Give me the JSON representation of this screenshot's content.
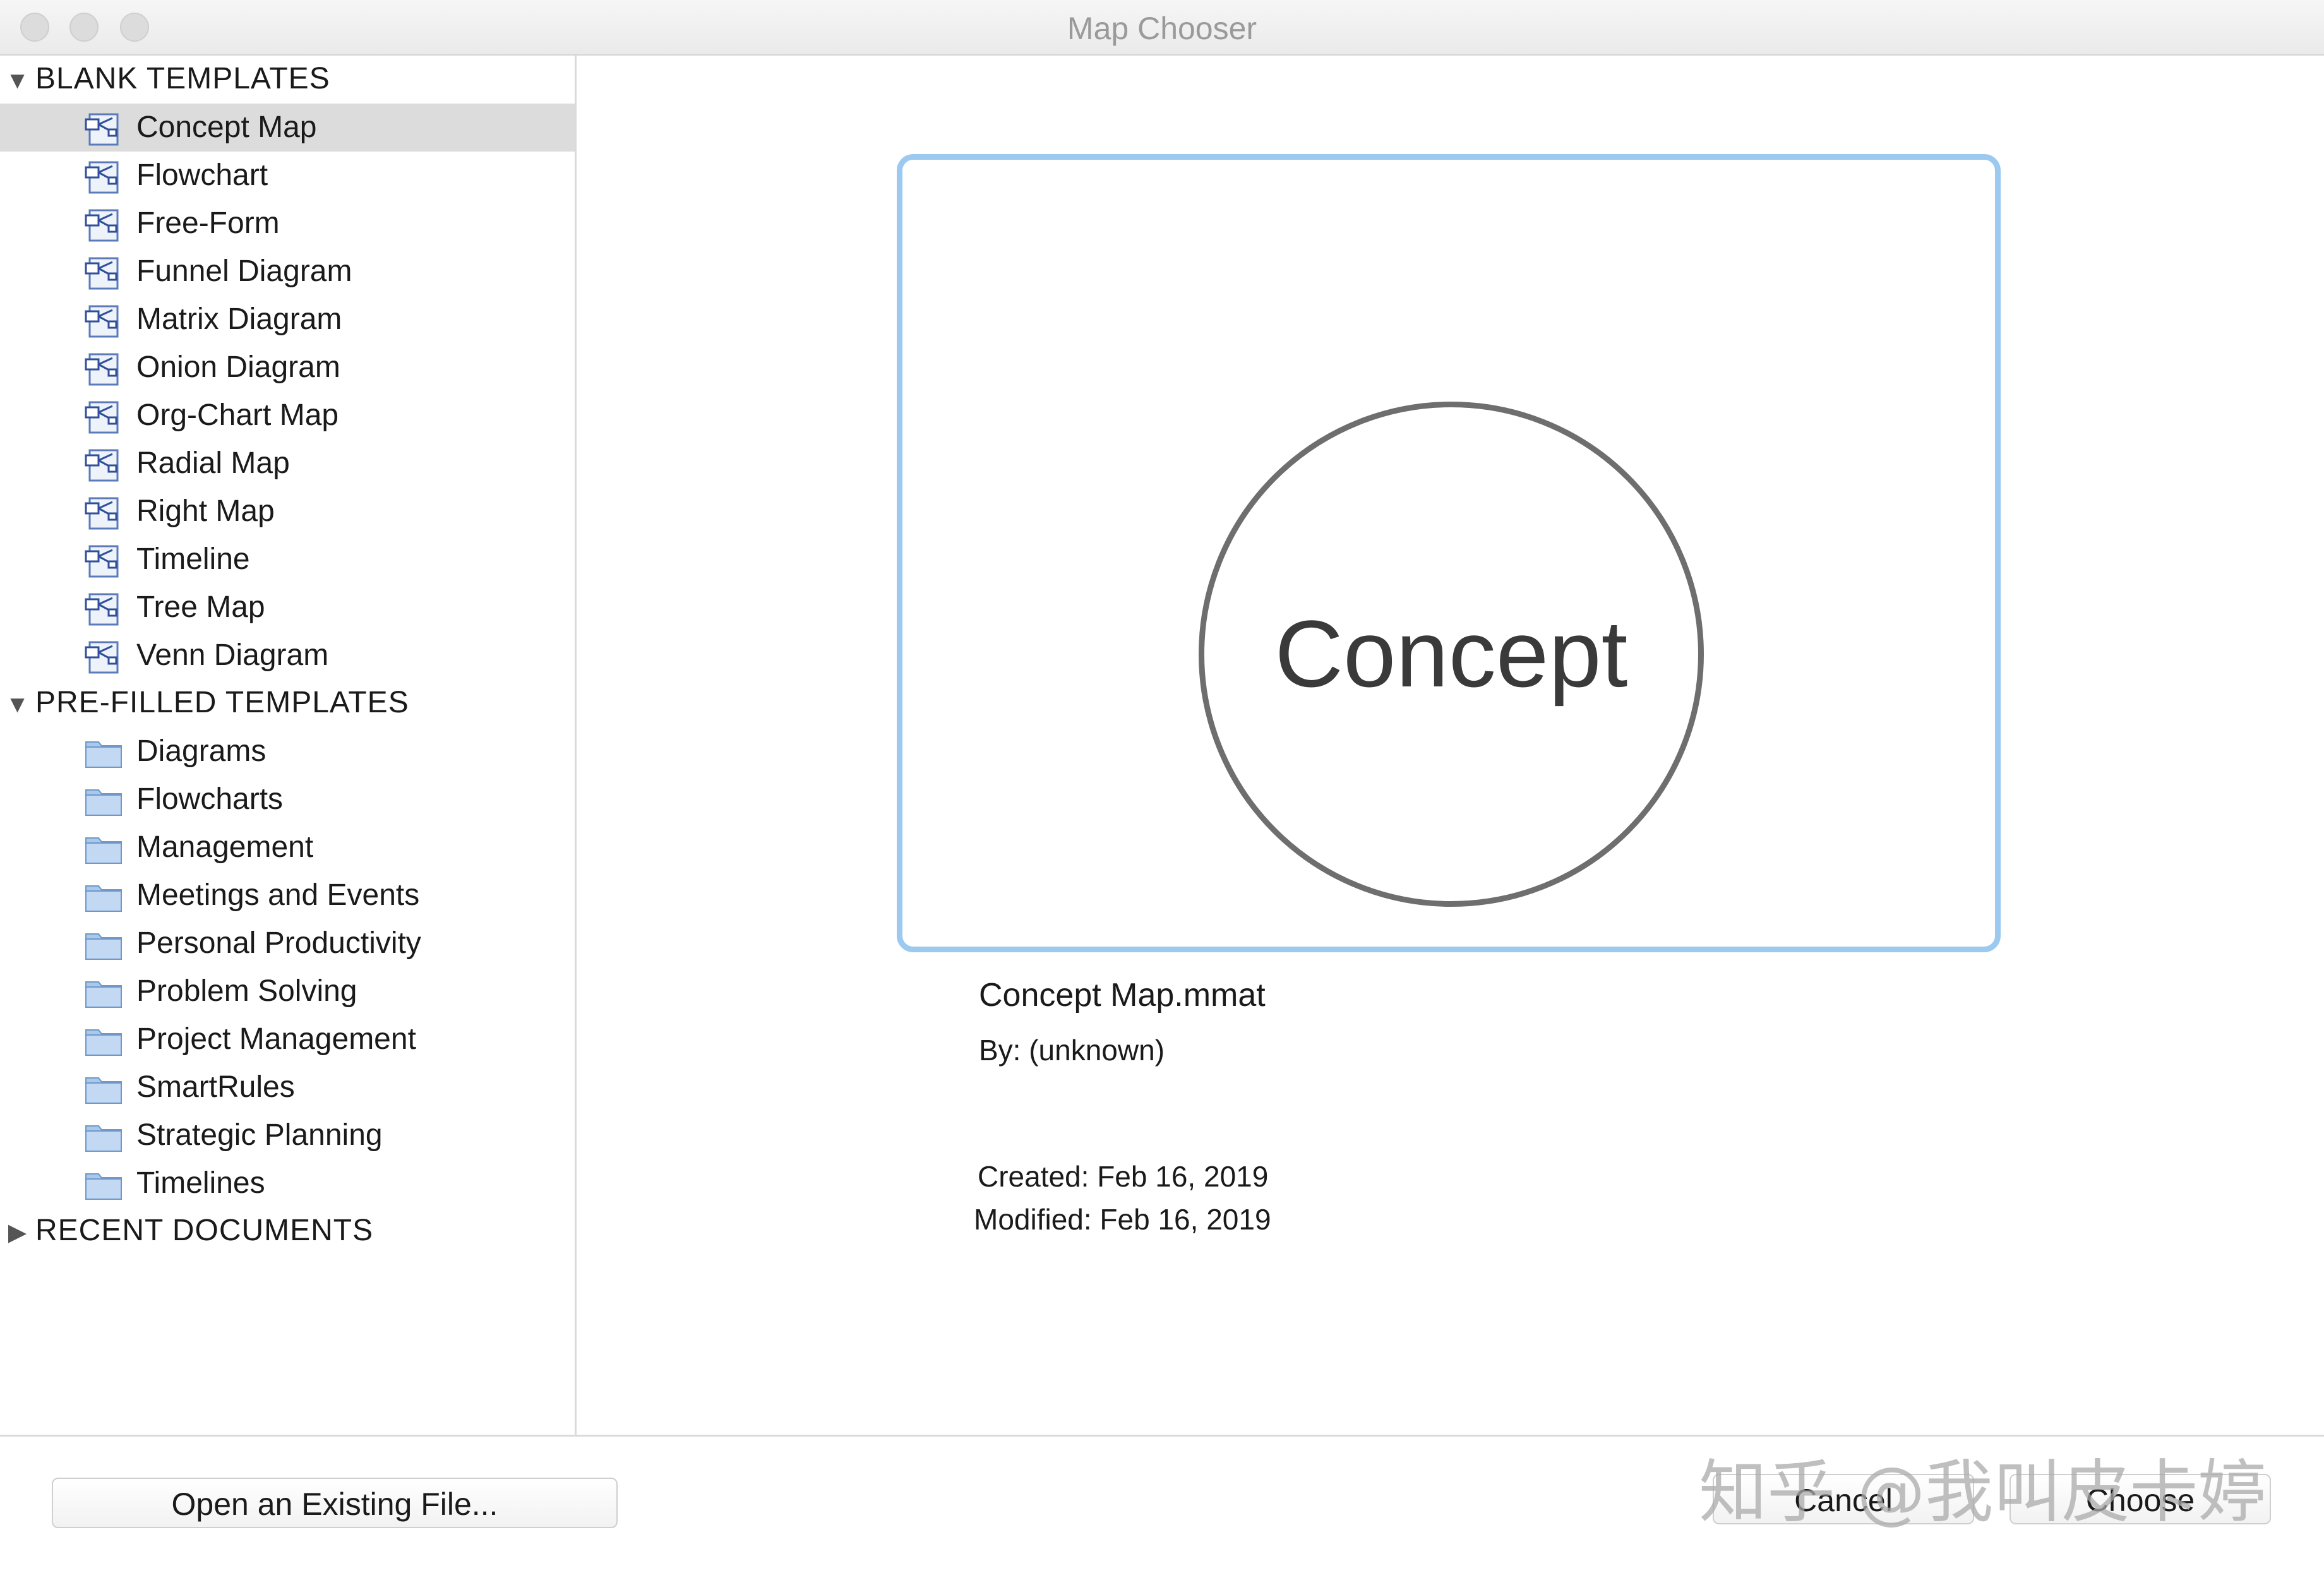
{
  "window": {
    "title": "Map Chooser"
  },
  "sidebar": {
    "blank": {
      "header": "BLANK TEMPLATES",
      "items": [
        {
          "label": "Concept Map",
          "selected": true
        },
        {
          "label": "Flowchart"
        },
        {
          "label": "Free-Form"
        },
        {
          "label": "Funnel Diagram"
        },
        {
          "label": "Matrix Diagram"
        },
        {
          "label": "Onion Diagram"
        },
        {
          "label": "Org-Chart Map"
        },
        {
          "label": "Radial Map"
        },
        {
          "label": "Right Map"
        },
        {
          "label": "Timeline"
        },
        {
          "label": "Tree Map"
        },
        {
          "label": "Venn Diagram"
        }
      ]
    },
    "prefilled": {
      "header": "PRE-FILLED TEMPLATES",
      "items": [
        {
          "label": "Diagrams"
        },
        {
          "label": "Flowcharts"
        },
        {
          "label": "Management"
        },
        {
          "label": "Meetings and Events"
        },
        {
          "label": "Personal Productivity"
        },
        {
          "label": "Problem Solving"
        },
        {
          "label": "Project Management"
        },
        {
          "label": "SmartRules"
        },
        {
          "label": "Strategic Planning"
        },
        {
          "label": "Timelines"
        }
      ]
    },
    "recent": {
      "header": "RECENT DOCUMENTS",
      "expanded": false
    }
  },
  "preview": {
    "image_text": "Concept",
    "filename": "Concept Map.mmat",
    "author": "By: (unknown)",
    "created": "Created: Feb 16, 2019",
    "modified": "Modified: Feb 16, 2019",
    "accent_color": "#9cc9f0"
  },
  "footer": {
    "open_label": "Open an Existing File...",
    "cancel_label": "Cancel",
    "choose_label": "Choose",
    "watermark": "知乎 @我叫皮卡婷"
  },
  "icons": {
    "template": "template-file-icon",
    "folder": "folder-icon",
    "disclosure_open": "disclosure-open-icon",
    "disclosure_closed": "disclosure-closed-icon"
  }
}
